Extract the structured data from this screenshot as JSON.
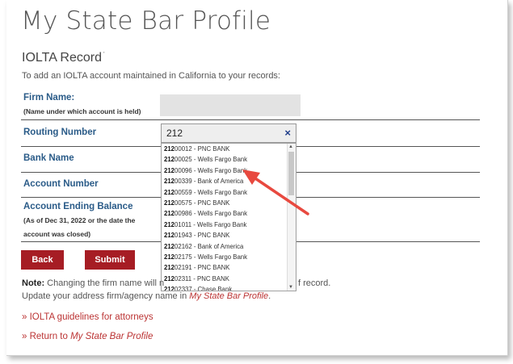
{
  "page": {
    "title": "My State Bar Profile",
    "section_title": "IOLTA Record",
    "section_mark": "'",
    "intro": "To add an IOLTA account maintained in California to your records:"
  },
  "form": {
    "firm_name_label": "Firm Name:",
    "firm_name_sublabel": "(Name under which account is held)",
    "firm_name_value": "",
    "routing_label": "Routing Number",
    "routing_value": "212",
    "routing_clear": "×",
    "bank_name_label": "Bank Name",
    "account_number_label": "Account Number",
    "balance_label": "Account Ending Balance",
    "balance_sublabel_1": "(As of Dec 31, 2022 or the date the",
    "balance_sublabel_2": "account was closed)"
  },
  "dropdown": {
    "match": "212",
    "options": [
      {
        "rest": "00012 - PNC BANK"
      },
      {
        "rest": "00025 - Wells Fargo Bank"
      },
      {
        "rest": "00096 - Wells Fargo Bank"
      },
      {
        "rest": "00339 - Bank of America"
      },
      {
        "rest": "00559 - Wells Fargo Bank"
      },
      {
        "rest": "00575 - PNC BANK"
      },
      {
        "rest": "00986 - Wells Fargo Bank"
      },
      {
        "rest": "01011 - Wells Fargo Bank"
      },
      {
        "rest": "01943 - PNC BANK"
      },
      {
        "rest": "02162 - Bank of America"
      },
      {
        "rest": "02175 - Wells Fargo Bank"
      },
      {
        "rest": "02191 - PNC BANK"
      },
      {
        "rest": "02311 - PNC BANK"
      },
      {
        "rest": "02337 - Chase Bank"
      }
    ]
  },
  "buttons": {
    "back": "Back",
    "submit": "Submit"
  },
  "note": {
    "label": "Note:",
    "text_a": " Changing the firm name will n",
    "text_b": "f record.",
    "line2_a": "Update your address firm/agency name in ",
    "line2_link": "My State Bar Profile",
    "line2_end": "."
  },
  "links": {
    "guidelines": "» IOLTA guidelines for attorneys",
    "return_prefix": "» Return to ",
    "return_target": "My State Bar Profile"
  },
  "colors": {
    "label_blue": "#2a5b88",
    "button_red": "#a61d24",
    "link_red": "#b33333",
    "callout_red": "#e8493f"
  }
}
